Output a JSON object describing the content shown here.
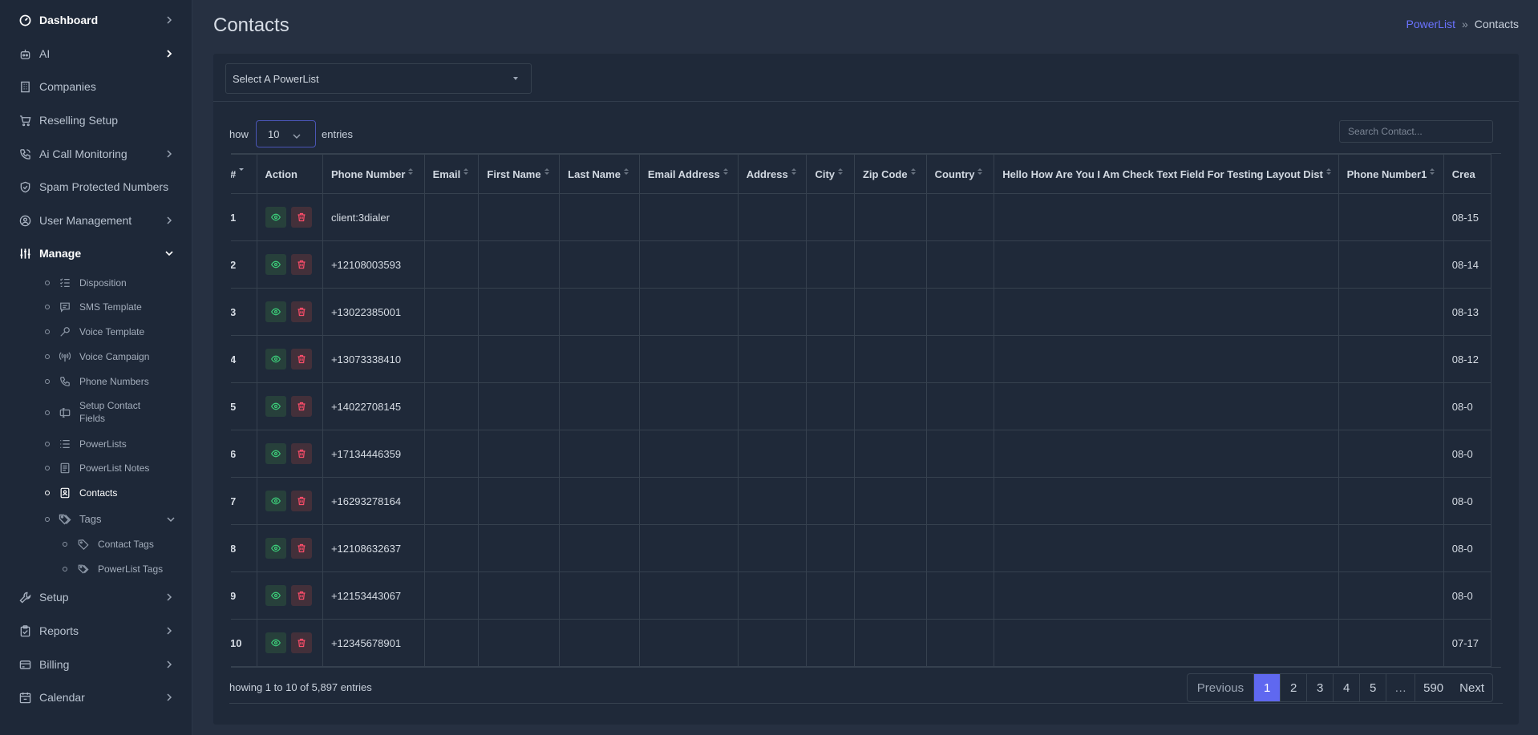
{
  "sidebar": {
    "items": [
      {
        "label": "Dashboard",
        "icon": "gauge-icon"
      },
      {
        "label": "AI",
        "icon": "robot-icon"
      },
      {
        "label": "Companies",
        "icon": "building-icon"
      },
      {
        "label": "Reselling Setup",
        "icon": "cart-icon"
      },
      {
        "label": "Ai Call Monitoring",
        "icon": "phone-call-icon"
      },
      {
        "label": "Spam Protected Numbers",
        "icon": "shield-icon"
      },
      {
        "label": "User Management",
        "icon": "user-circle-icon"
      },
      {
        "label": "Manage",
        "icon": "sliders-icon"
      }
    ],
    "manage_sub": [
      {
        "label": "Disposition"
      },
      {
        "label": "SMS Template"
      },
      {
        "label": "Voice Template"
      },
      {
        "label": "Voice Campaign"
      },
      {
        "label": "Phone Numbers"
      },
      {
        "label": "Setup Contact Fields"
      },
      {
        "label": "PowerLists"
      },
      {
        "label": "PowerList Notes"
      },
      {
        "label": "Contacts"
      },
      {
        "label": "Tags"
      }
    ],
    "tags_sub": [
      {
        "label": "Contact Tags"
      },
      {
        "label": "PowerList Tags"
      }
    ],
    "bottom": [
      {
        "label": "Setup"
      },
      {
        "label": "Reports"
      },
      {
        "label": "Billing"
      },
      {
        "label": "Calendar"
      }
    ]
  },
  "header": {
    "title": "Contacts",
    "breadcrumb_link": "PowerList",
    "breadcrumb_sep": "»",
    "breadcrumb_current": "Contacts"
  },
  "filter": {
    "powerlist_select": "Select A PowerList"
  },
  "table_controls": {
    "show_label": "how",
    "page_size": "10",
    "entries_label": "entries",
    "search_placeholder": "Search Contact..."
  },
  "table": {
    "columns": [
      "#",
      "Action",
      "Phone Number",
      "Email",
      "First Name",
      "Last Name",
      "Email Address",
      "Address",
      "City",
      "Zip Code",
      "Country",
      "Hello How Are You I Am Check Text Field For Testing Layout Dist",
      "Phone Number1",
      "Crea"
    ],
    "rows": [
      {
        "num": "1",
        "phone": "client:3dialer",
        "created": "08-15"
      },
      {
        "num": "2",
        "phone": "+12108003593",
        "created": "08-14"
      },
      {
        "num": "3",
        "phone": "+13022385001",
        "created": "08-13"
      },
      {
        "num": "4",
        "phone": "+13073338410",
        "created": "08-12"
      },
      {
        "num": "5",
        "phone": "+14022708145",
        "created": "08-0"
      },
      {
        "num": "6",
        "phone": "+17134446359",
        "created": "08-0"
      },
      {
        "num": "7",
        "phone": "+16293278164",
        "created": "08-0"
      },
      {
        "num": "8",
        "phone": "+12108632637",
        "created": "08-0"
      },
      {
        "num": "9",
        "phone": "+12153443067",
        "created": "08-0"
      },
      {
        "num": "10",
        "phone": "+12345678901",
        "created": "07-17"
      }
    ]
  },
  "footer": {
    "info": "howing 1 to 10 of 5,897 entries",
    "prev": "Previous",
    "pages": [
      "1",
      "2",
      "3",
      "4",
      "5",
      "…",
      "590"
    ],
    "next": "Next"
  },
  "colors": {
    "accent": "#5f68f0",
    "view": "#3ccf7a",
    "delete": "#ff4d6a"
  }
}
